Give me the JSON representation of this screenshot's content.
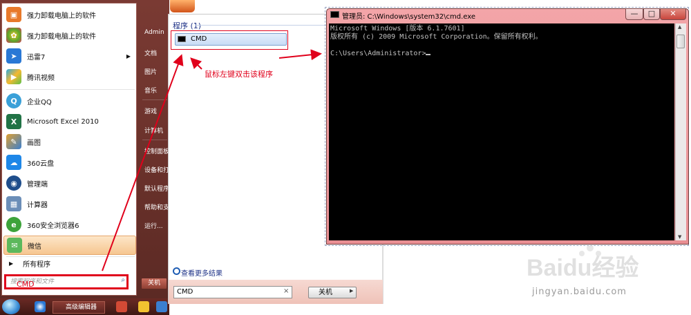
{
  "start_menu": {
    "apps": [
      {
        "label": "强力卸载电脑上的软件",
        "icon": "uninstall-box-icon",
        "color": "#e8792a"
      },
      {
        "label": "强力卸载电脑上的软件",
        "icon": "colorful-flower-icon",
        "color": "#5aa829"
      },
      {
        "label": "迅雷7",
        "icon": "thunder-bird-icon",
        "color": "#2a78d5",
        "has_submenu": true
      },
      {
        "label": "腾讯视频",
        "icon": "tencent-video-icon",
        "color": "#27a8e0"
      },
      {
        "label": "企业QQ",
        "icon": "qq-penguin-icon",
        "color": "#3aa0d8"
      },
      {
        "label": "Microsoft Excel 2010",
        "icon": "excel-icon",
        "color": "#217346"
      },
      {
        "label": "画图",
        "icon": "paint-palette-icon",
        "color": "#e0a030"
      },
      {
        "label": "360云盘",
        "icon": "cloud-disk-icon",
        "color": "#1e87e8"
      },
      {
        "label": "管理端",
        "icon": "eye-icon",
        "color": "#1f4e8c"
      },
      {
        "label": "计算器",
        "icon": "calculator-icon",
        "color": "#6b8eb8"
      },
      {
        "label": "360安全浏览器6",
        "icon": "browser-e-icon",
        "color": "#3da33a"
      },
      {
        "label": "微信",
        "icon": "wechat-icon",
        "color": "#5cb85c"
      }
    ],
    "all_programs": "所有程序",
    "search_placeholder": "搜索程序和文件",
    "search_overlay": "CMD",
    "right_items": [
      "Admin",
      "文档",
      "图片",
      "音乐",
      "游戏",
      "计算机",
      "控制面板",
      "设备和打",
      "默认程序",
      "帮助和支",
      "运行..."
    ],
    "shutdown": "关机",
    "taskbar_task": "高级编辑器"
  },
  "results_panel": {
    "section_label": "程序 (1)",
    "result_item": "CMD",
    "annotation": "鼠标左键双击该程序",
    "see_more": "查看更多结果",
    "search_value": "CMD",
    "clear_glyph": "×",
    "shutdown": "关机"
  },
  "cmd_window": {
    "title": "管理员: C:\\Windows\\system32\\cmd.exe",
    "lines": [
      "Microsoft Windows [版本 6.1.7601]",
      "版权所有 (c) 2009 Microsoft Corporation。保留所有权利。",
      "",
      "C:\\Users\\Administrator>"
    ],
    "buttons": {
      "minimize": "—",
      "maximize": "□",
      "close": "✕"
    },
    "close_color": "#c9463d"
  },
  "watermark": {
    "logo": "Baidu经验",
    "url": "jingyan.baidu.com"
  },
  "colors": {
    "annotation_red": "#e0001b",
    "link_blue": "#1e3287"
  }
}
